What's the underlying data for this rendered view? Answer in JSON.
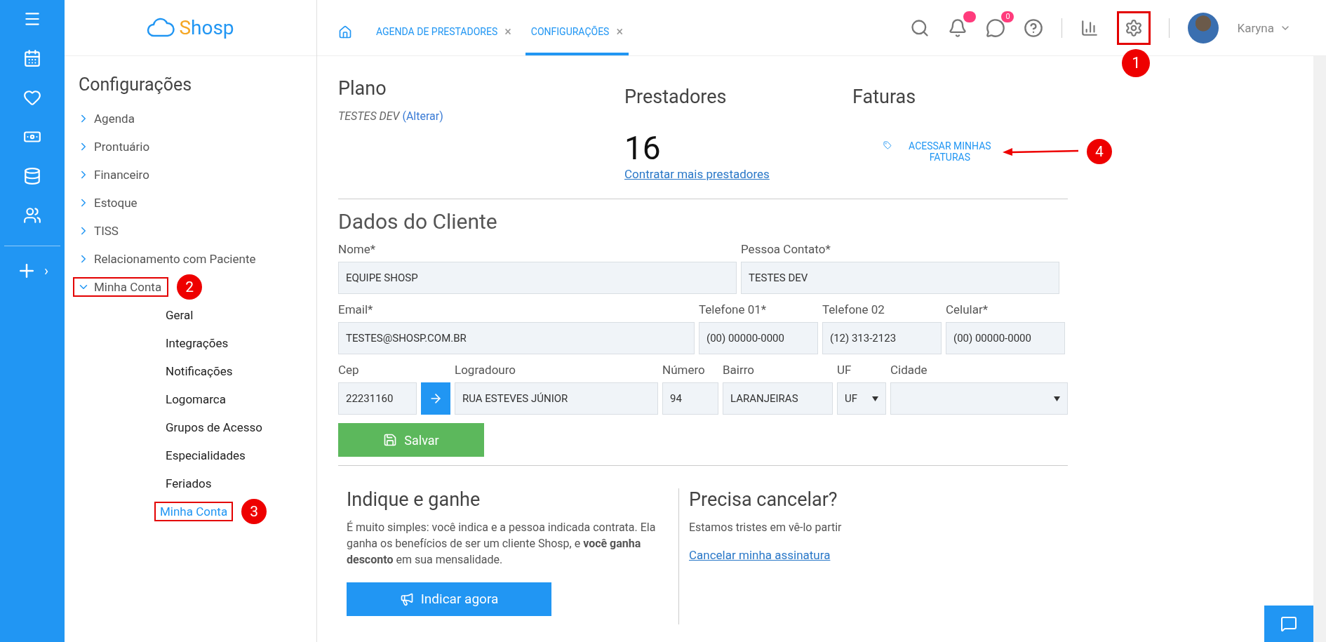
{
  "rail": {
    "chevron": "›"
  },
  "logo": {
    "text": "Shosp"
  },
  "sidebar": {
    "title": "Configurações",
    "items": [
      {
        "label": "Agenda",
        "expanded": false,
        "highlighted": false
      },
      {
        "label": "Prontuário",
        "expanded": false,
        "highlighted": false
      },
      {
        "label": "Financeiro",
        "expanded": false,
        "highlighted": false
      },
      {
        "label": "Estoque",
        "expanded": false,
        "highlighted": false
      },
      {
        "label": "TISS",
        "expanded": false,
        "highlighted": false
      },
      {
        "label": "Relacionamento com Paciente",
        "expanded": false,
        "highlighted": false
      },
      {
        "label": "Minha Conta",
        "expanded": true,
        "highlighted": true,
        "badge": "2",
        "children": [
          {
            "label": "Geral",
            "selected": false,
            "highlighted": false
          },
          {
            "label": "Integrações",
            "selected": false,
            "highlighted": false
          },
          {
            "label": "Notificações",
            "selected": false,
            "highlighted": false
          },
          {
            "label": "Logomarca",
            "selected": false,
            "highlighted": false
          },
          {
            "label": "Grupos de Acesso",
            "selected": false,
            "highlighted": false
          },
          {
            "label": "Especialidades",
            "selected": false,
            "highlighted": false
          },
          {
            "label": "Feriados",
            "selected": false,
            "highlighted": false
          },
          {
            "label": "Minha Conta",
            "selected": true,
            "highlighted": true,
            "badge": "3"
          }
        ]
      }
    ]
  },
  "tabs": [
    {
      "label": "AGENDA DE PRESTADORES",
      "selected": false,
      "close": "×"
    },
    {
      "label": "CONFIGURAÇÕES",
      "selected": true,
      "close": "×"
    }
  ],
  "header": {
    "notification_dot": true,
    "chat_badge": "0",
    "settings_highlighted": true,
    "settings_badge": "1",
    "user": "Karyna"
  },
  "plano": {
    "title": "Plano",
    "name": "TESTES DEV",
    "link": "(Alterar)"
  },
  "prestadores": {
    "title": "Prestadores",
    "count": "16",
    "link": "Contratar mais prestadores"
  },
  "faturas": {
    "title": "Faturas",
    "link": "ACESSAR MINHAS FATURAS",
    "badge": "4"
  },
  "cliente": {
    "title": "Dados do Cliente",
    "fields": [
      {
        "label": "Nome*",
        "value": "EQUIPE SHOSP",
        "kind": "text"
      },
      {
        "label": "Pessoa Contato*",
        "value": "TESTES DEV",
        "kind": "text"
      },
      {
        "label": "Email*",
        "value": "TESTES@SHOSP.COM.BR",
        "kind": "text"
      },
      {
        "label": "Telefone 01*",
        "value": "(00) 00000-0000",
        "kind": "text"
      },
      {
        "label": "Telefone 02",
        "value": "(12) 313-2123",
        "kind": "text"
      },
      {
        "label": "Celular*",
        "value": "(00) 00000-0000",
        "kind": "text"
      },
      {
        "label": "Cep",
        "value": "22231160",
        "kind": "cep"
      },
      {
        "label": "Logradouro",
        "value": "RUA ESTEVES JÚNIOR",
        "kind": "text"
      },
      {
        "label": "Número",
        "value": "94",
        "kind": "text"
      },
      {
        "label": "Bairro",
        "value": "LARANJEIRAS",
        "kind": "text"
      },
      {
        "label": "UF",
        "value": "UF",
        "kind": "select"
      },
      {
        "label": "Cidade",
        "kind": "select"
      }
    ],
    "save": "Salvar"
  },
  "indique": {
    "title": "Indique e ganhe",
    "text": "É muito simples: você indica e a pessoa indicada contrata. Ela ganha os benefícios de ser um cliente Shosp, e **você ganha desconto** em sua mensalidade.",
    "button": "Indicar agora"
  },
  "cancelar": {
    "title": "Precisa cancelar?",
    "text": "Estamos tristes em vê-lo partir",
    "link": "Cancelar minha assinatura"
  }
}
